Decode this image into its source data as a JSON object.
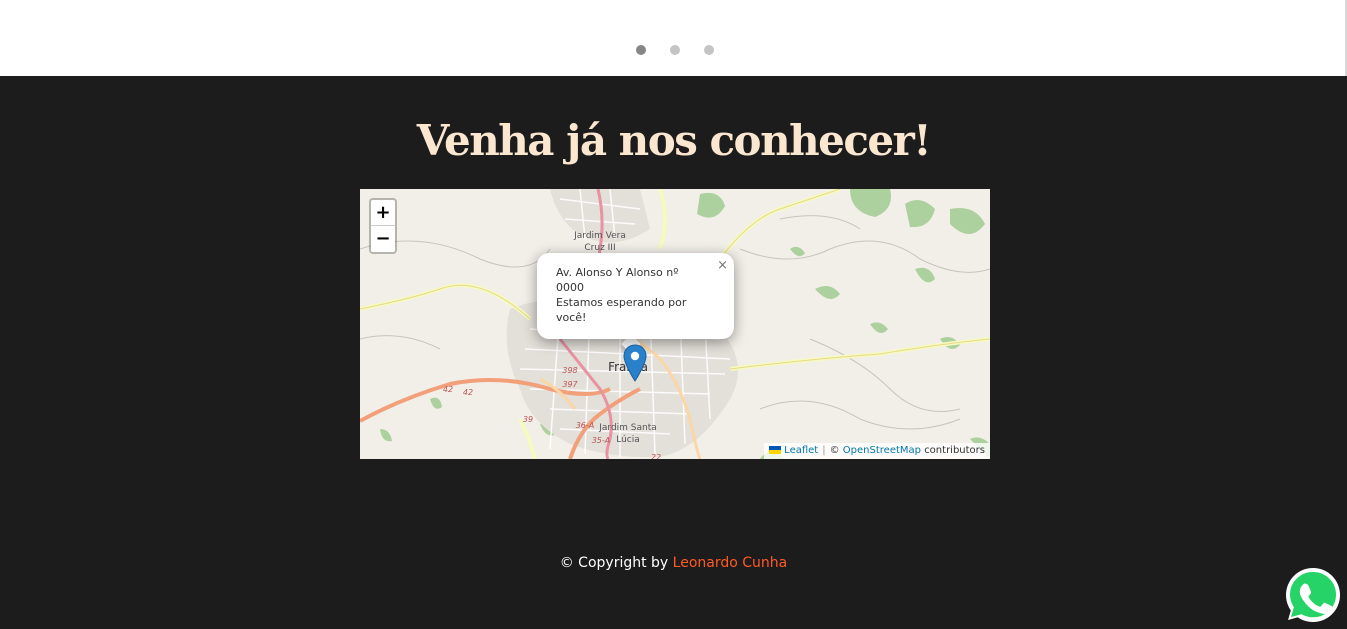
{
  "carousel": {
    "dots": 3,
    "active_index": 0
  },
  "section": {
    "heading": "Venha já nos conhecer!"
  },
  "map": {
    "zoom_in_label": "+",
    "zoom_out_label": "−",
    "place_labels": {
      "jardim_vera_1": "Jardim Vera",
      "jardim_vera_2": "Cruz III",
      "city": "Franca",
      "santa_lucia_1": "Jardim Santa",
      "santa_lucia_2": "Lúcia"
    },
    "road_labels": [
      "398",
      "397",
      "42",
      "42",
      "39",
      "36-A",
      "35-A",
      "22"
    ],
    "popup": {
      "line1": "Av. Alonso Y Alonso nº",
      "line2": "0000",
      "line3": "Estamos esperando por",
      "line4": "você!",
      "close_label": "×"
    },
    "attribution": {
      "leaflet": "Leaflet",
      "separator": "|",
      "copyright": "©",
      "osm": "OpenStreetMap",
      "contributors": "contributors"
    }
  },
  "footer": {
    "copyright_prefix": "© Copyright by",
    "author": "Leonardo Cunha"
  },
  "colors": {
    "heading": "#fbe6cf",
    "author": "#ff5a24",
    "background": "#1c1c1c",
    "marker": "#2a81cb",
    "whatsapp": "#25d366"
  },
  "icons": {
    "marker": "map-marker-icon",
    "whatsapp": "whatsapp-icon"
  }
}
